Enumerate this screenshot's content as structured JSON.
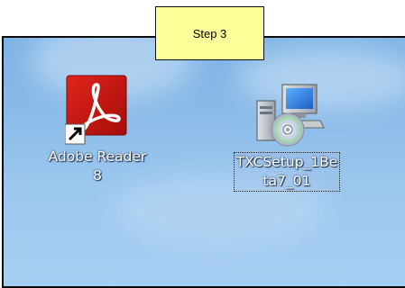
{
  "callout": {
    "text": "Step 3"
  },
  "desktop": {
    "icons": [
      {
        "label_line1": "Adobe Reader",
        "label_line2": "8",
        "icon": "adobe-reader-pdf-icon",
        "shortcut": true
      },
      {
        "label_line1": "TXCSetup_1Be",
        "label_line2": "ta7_01",
        "icon": "installer-setup-icon",
        "selected": true
      }
    ]
  },
  "colors": {
    "callout_bg": "#ffff99",
    "desktop_bg": "#8abbe8",
    "adobe_red": "#c8140f"
  }
}
